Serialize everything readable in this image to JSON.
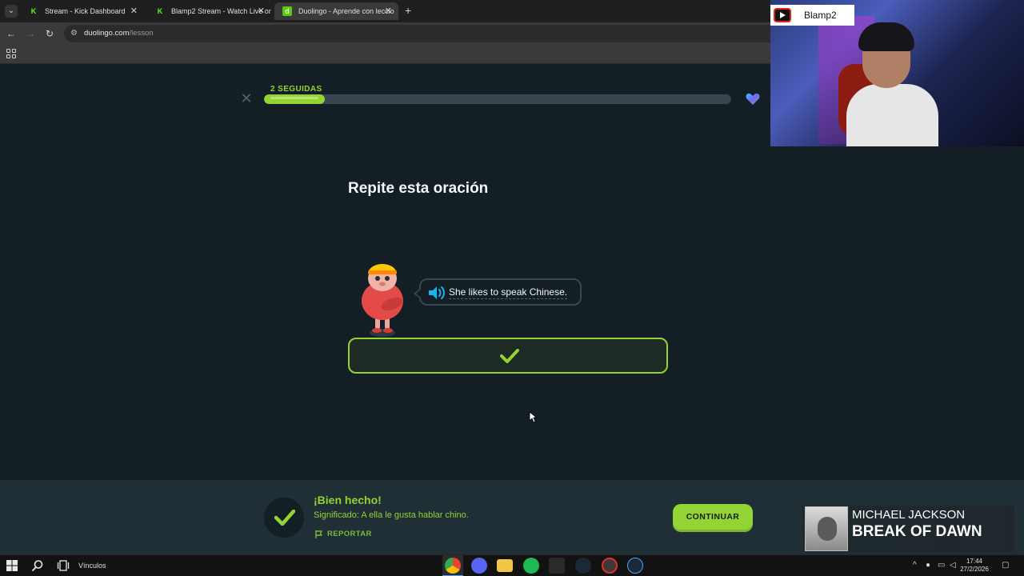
{
  "browser": {
    "tabs": [
      {
        "title": "Stream - Kick Dashboard",
        "favicon": "kick-icon",
        "active": false
      },
      {
        "title": "Blamp2 Stream - Watch Live on",
        "favicon": "kick-icon",
        "active": false
      },
      {
        "title": "Duolingo - Aprende con leccio",
        "favicon": "duolingo-icon",
        "active": true
      }
    ],
    "url": "duolingo.com",
    "url_path": "/lesson"
  },
  "lesson": {
    "streak_label": "2 SEGUIDAS",
    "progress_fraction": 0.13,
    "challenge_title": "Repite esta oración",
    "sentence": "She likes to speak Chinese."
  },
  "webcam": {
    "channel_name": "Blamp2"
  },
  "feedback": {
    "title": "¡Bien hecho!",
    "meaning": "Significado: A ella le gusta hablar chino.",
    "report_label": "REPORTAR",
    "continue_label": "CONTINUAR"
  },
  "music": {
    "artist": "MICHAEL JACKSON",
    "song": "BREAK OF DAWN"
  },
  "taskbar": {
    "search_label": "Vínculos",
    "time": "17:44",
    "date": "27/2/2026"
  },
  "colors": {
    "background": "#131f24",
    "accent_green": "#93d333",
    "footer": "#202f36"
  }
}
